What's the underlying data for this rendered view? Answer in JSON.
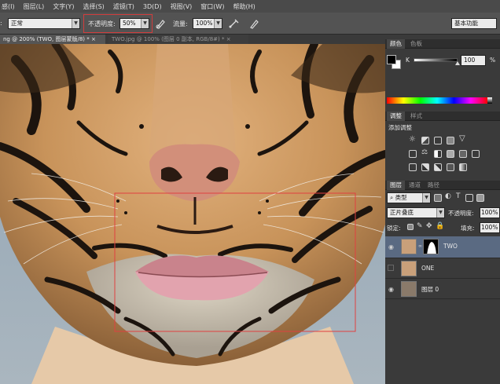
{
  "menu": [
    "感(I)",
    "图层(L)",
    "文字(Y)",
    "选择(S)",
    "滤镜(T)",
    "3D(D)",
    "视图(V)",
    "窗口(W)",
    "帮助(H)"
  ],
  "options": {
    "blend_mode": "正常",
    "opacity_label": "不透明度:",
    "opacity_value": "50%",
    "flow_label": "流量:",
    "flow_value": "100%",
    "workspace": "基本功能"
  },
  "tabs": [
    {
      "label": "ng @ 200% (TWO, 图层蒙版/8) *",
      "close": "×",
      "active": true
    },
    {
      "label": "TWO.jpg @ 100% (图层 0 副本, RGB/8#) *",
      "close": "×",
      "active": false
    }
  ],
  "color_panel": {
    "tabs": [
      "颜色",
      "色板"
    ],
    "channel": "K",
    "value": "100",
    "unit": "%"
  },
  "adjust_panel": {
    "tabs": [
      "调整",
      "样式"
    ],
    "title": "添加调整"
  },
  "layers_panel": {
    "tabs": [
      "图层",
      "通道",
      "路径"
    ],
    "filter_kind": "类型",
    "blend_mode": "正片叠底",
    "opacity_label": "不透明度:",
    "opacity_value": "100%",
    "lock_label": "锁定:",
    "fill_label": "填充:",
    "fill_value": "100%",
    "layers": [
      {
        "name": "TWO",
        "selected": true,
        "visible": true
      },
      {
        "name": "ONE",
        "selected": false,
        "visible": false
      },
      {
        "name": "图层 0",
        "selected": false,
        "visible": true
      }
    ]
  },
  "colors": {
    "selection_rect": "#e04040",
    "highlight": "#5a6a82"
  }
}
